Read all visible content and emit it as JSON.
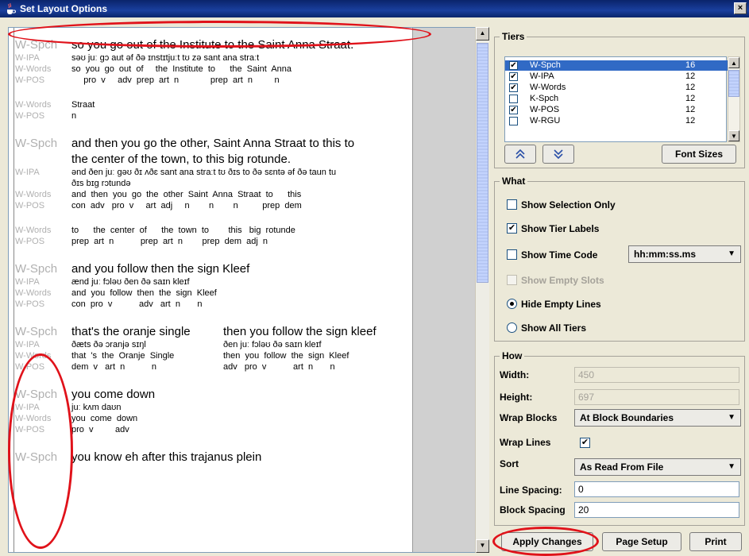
{
  "window": {
    "title": "Set Layout Options",
    "close_label": "×"
  },
  "preview": {
    "blocks": [
      {
        "big": {
          "label": "W-Spch",
          "text": "so you go out of the Institute to the Saint Anna Straat."
        },
        "rows": [
          {
            "label": "W-IPA",
            "text": "səʊ juː ɡɔ aut əf ðə ɪnstɪtjuːt tʊ zə sant ana straːt"
          },
          {
            "label": "W-Words",
            "text": "so  you  go  out  of     the  Institute  to      the  Saint  Anna"
          },
          {
            "label": "W-POS",
            "text": "     pro  v     adv  prep  art  n             prep  art  n         n"
          }
        ]
      },
      {
        "rows": [
          {
            "label": "W-Words",
            "text": "Straat"
          },
          {
            "label": "W-POS",
            "text": "n"
          }
        ]
      },
      {
        "big": {
          "label": "W-Spch",
          "text": "and then you go the other, Saint Anna Straat to this to"
        },
        "big2": "the center of the town, to this big rotunde.",
        "rows": [
          {
            "label": "W-IPA",
            "text": "ənd ðen juː ɡəʊ ðɪ ʌðɛ sant ana straːt tʊ ðɪs to ðə sɛntə əf ðə taun tu"
          },
          {
            "label": "",
            "text": "ðɪs bɪɡ rɔtundə"
          },
          {
            "label": "W-Words",
            "text": "and  then  you  go  the  other  Saint  Anna  Straat  to      this"
          },
          {
            "label": "W-POS",
            "text": "con  adv   pro  v     art  adj     n        n        n          prep  dem"
          }
        ]
      },
      {
        "rows": [
          {
            "label": "W-Words",
            "text": "to      the  center  of      the  town  to        this   big  rotunde"
          },
          {
            "label": "W-POS",
            "text": "prep  art  n           prep  art  n        prep  dem  adj  n"
          }
        ]
      },
      {
        "big": {
          "label": "W-Spch",
          "text": "and you follow then the sign Kleef"
        },
        "rows": [
          {
            "label": "W-IPA",
            "text": "ænd juː fɔləʊ ðen ðə saɪn kleɪf"
          },
          {
            "label": "W-Words",
            "text": "and  you  follow  then  the  sign  Kleef"
          },
          {
            "label": "W-POS",
            "text": "con  pro  v           adv   art  n       n"
          }
        ]
      },
      {
        "big": {
          "label": "W-Spch",
          "text": "that's the oranje single",
          "text2": "then you follow the sign kleef"
        },
        "rows": [
          {
            "label": "W-IPA",
            "text": "ðæts ðə ɔranjə sɪŋl",
            "text2": "ðen juː fɔləʊ ðə saɪn kleɪf"
          },
          {
            "label": "W-Words",
            "text": "that  's  the  Oranje  Single",
            "text2": "then  you  follow  the  sign  Kleef"
          },
          {
            "label": "W-POS",
            "text": "dem  v   art  n           n",
            "text2": "adv   pro  v           art  n       n"
          }
        ]
      },
      {
        "big": {
          "label": "W-Spch",
          "text": "you come down"
        },
        "rows": [
          {
            "label": "W-IPA",
            "text": "juː kʌm daʊn"
          },
          {
            "label": "W-Words",
            "text": "you  come  down"
          },
          {
            "label": "W-POS",
            "text": "pro  v         adv"
          }
        ]
      },
      {
        "big": {
          "label": "W-Spch",
          "text": "you know eh after this trajanus plein"
        },
        "rows": []
      }
    ]
  },
  "tiers": {
    "title": "Tiers",
    "items": [
      {
        "name": "W-Spch",
        "size": "16",
        "checked": true,
        "selected": true
      },
      {
        "name": "W-IPA",
        "size": "12",
        "checked": true,
        "selected": false
      },
      {
        "name": "W-Words",
        "size": "12",
        "checked": true,
        "selected": false
      },
      {
        "name": "K-Spch",
        "size": "12",
        "checked": false,
        "selected": false
      },
      {
        "name": "W-POS",
        "size": "12",
        "checked": true,
        "selected": false
      },
      {
        "name": "W-RGU",
        "size": "12",
        "checked": false,
        "selected": false
      }
    ],
    "up_icon": "double-chevron-up-icon",
    "down_icon": "double-chevron-down-icon",
    "font_sizes_label": "Font Sizes"
  },
  "what": {
    "title": "What",
    "show_selection_only": {
      "label": "Show Selection Only",
      "checked": false
    },
    "show_tier_labels": {
      "label": "Show Tier Labels",
      "checked": true
    },
    "show_time_code": {
      "label": "Show Time Code",
      "checked": false,
      "format": "hh:mm:ss.ms"
    },
    "show_empty_slots": {
      "label": "Show Empty Slots",
      "checked": false,
      "disabled": true
    },
    "hide_empty_lines": {
      "label": "Hide Empty Lines",
      "selected": true
    },
    "show_all_tiers": {
      "label": "Show All Tiers",
      "selected": false
    }
  },
  "how": {
    "title": "How",
    "width_label": "Width:",
    "width_value": "450",
    "height_label": "Height:",
    "height_value": "697",
    "wrap_blocks_label": "Wrap Blocks",
    "wrap_blocks_value": "At Block Boundaries",
    "wrap_lines_label": "Wrap Lines",
    "wrap_lines_checked": true,
    "sort_label": "Sort",
    "sort_value": "As Read From File",
    "line_spacing_label": "Line Spacing:",
    "line_spacing_value": "0",
    "block_spacing_label": "Block Spacing",
    "block_spacing_value": "20"
  },
  "buttons": {
    "apply": "Apply Changes",
    "page_setup": "Page Setup",
    "print": "Print"
  },
  "colors": {
    "annotation": "#e0121a",
    "selection": "#316ac5",
    "title_bar": "#0a246a"
  }
}
